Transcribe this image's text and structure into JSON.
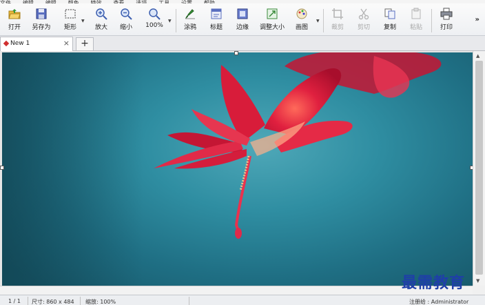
{
  "menu": [
    "文件",
    "编辑",
    "编辑",
    "颜色",
    "特效",
    "查看",
    "选项",
    "工具",
    "设置",
    "帮助"
  ],
  "toolbar": {
    "open": "打开",
    "save_as": "另存为",
    "rect": "矩形",
    "zoom_in": "放大",
    "zoom_out": "缩小",
    "zoom_100": "100%",
    "draw": "涂鸦",
    "title": "标题",
    "border": "边缘",
    "resize": "调整大小",
    "paint": "画图",
    "crop": "裁剪",
    "cut": "剪切",
    "copy": "复制",
    "paste": "粘贴",
    "print": "打印",
    "more": "»"
  },
  "tabs": {
    "active_name": "New 1",
    "close": "×",
    "new_tab": "+"
  },
  "status": {
    "page": "1 / 1",
    "size": "尺寸: 860 x 484",
    "zoom": "缩放: 100%",
    "registered": "注册给 : Administrator"
  },
  "watermark": "最需教育",
  "colors": {
    "accent": "#1f3fa8",
    "flower": "#d8183c",
    "background_teal": "#2f8ea2"
  }
}
